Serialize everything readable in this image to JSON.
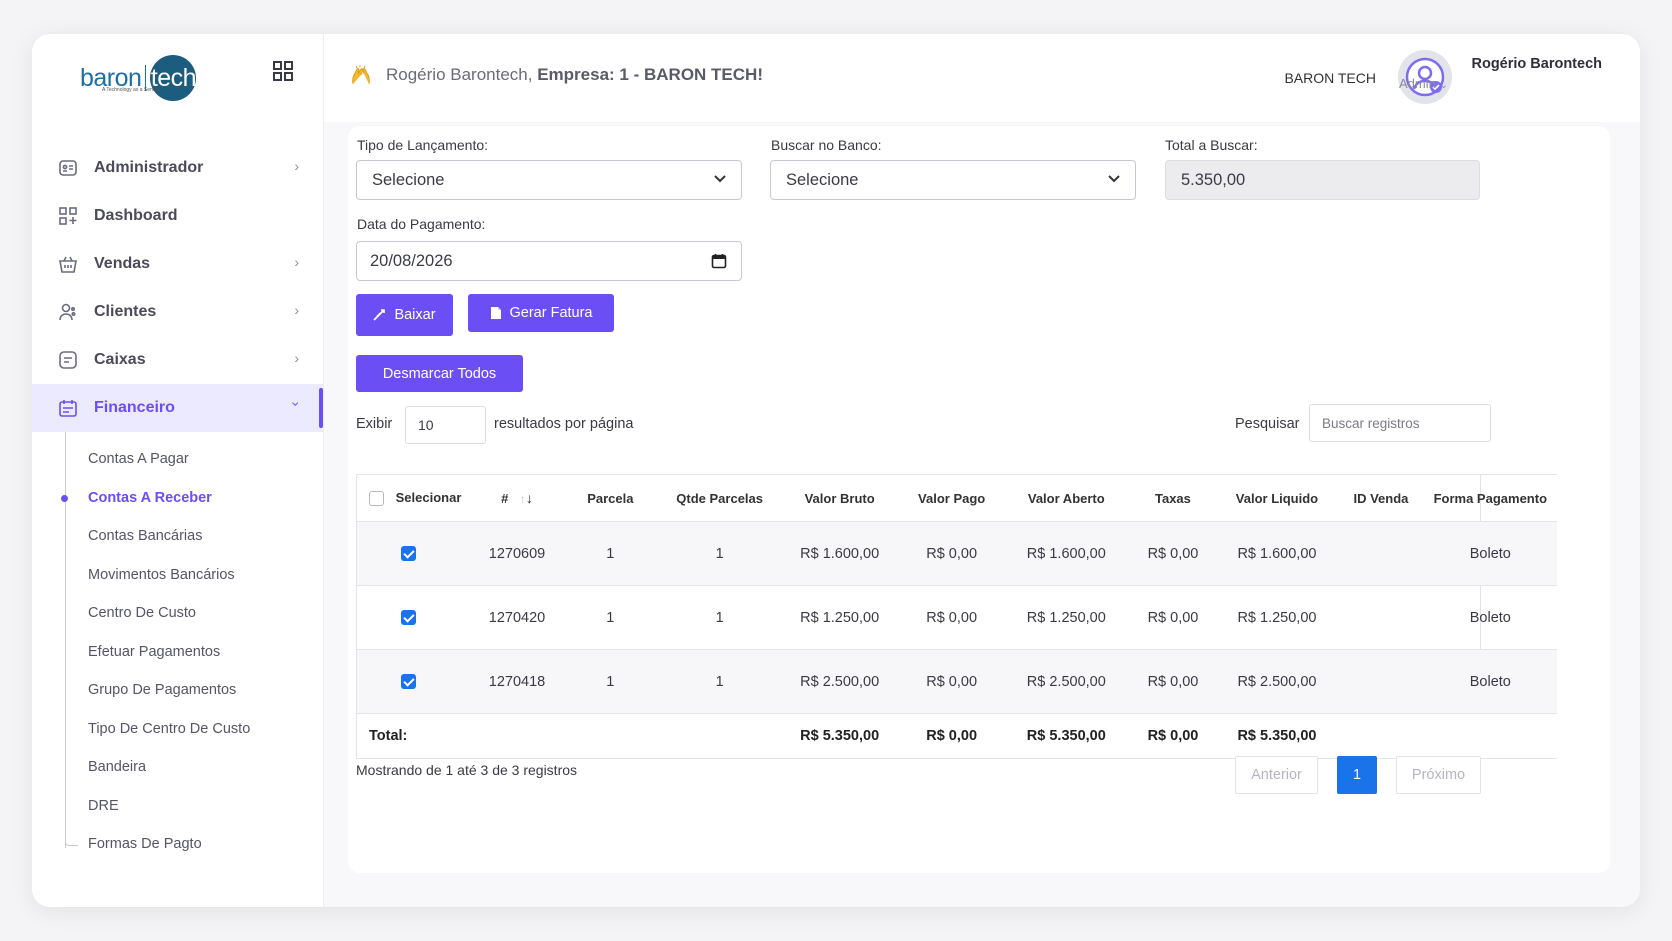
{
  "brand": {
    "logo_left": "baron",
    "logo_right": "tech",
    "tagline": "A Technology as a Service"
  },
  "sidebar": {
    "items": [
      {
        "label": "Administrador",
        "icon": "id-card-icon",
        "has_children": true
      },
      {
        "label": "Dashboard",
        "icon": "dashboard-grid-icon",
        "has_children": false
      },
      {
        "label": "Vendas",
        "icon": "basket-icon",
        "has_children": true
      },
      {
        "label": "Clientes",
        "icon": "users-icon",
        "has_children": true
      },
      {
        "label": "Caixas",
        "icon": "cashbox-icon",
        "has_children": true
      },
      {
        "label": "Financeiro",
        "icon": "calendar-icon",
        "has_children": true,
        "active": true
      }
    ],
    "submenu": [
      "Contas A Pagar",
      "Contas A Receber",
      "Contas Bancárias",
      "Movimentos Bancários",
      "Centro De Custo",
      "Efetuar Pagamentos",
      "Grupo De Pagamentos",
      "Tipo De Centro De Custo",
      "Bandeira",
      "DRE",
      "Formas De Pagto"
    ],
    "submenu_active_index": 1
  },
  "header": {
    "greeting_user": "Rogério Barontech,",
    "greeting_company": "Empresa: 1 - BARON TECH!",
    "company": "BARON TECH",
    "user_name": "Rogério Barontech",
    "user_role": "Admin"
  },
  "form": {
    "tipo_label": "Tipo de Lançamento:",
    "tipo_value": "Selecione",
    "banco_label": "Buscar no Banco:",
    "banco_value": "Selecione",
    "total_label": "Total a Buscar:",
    "total_value": "5.350,00",
    "data_label": "Data do Pagamento:",
    "data_value": "20/08/2026"
  },
  "buttons": {
    "baixar": "Baixar",
    "gerar_fatura": "Gerar Fatura",
    "desmarcar": "Desmarcar Todos"
  },
  "table_controls": {
    "show_label": "Exibir",
    "page_length": "10",
    "per_page_label": "resultados por página",
    "search_label": "Pesquisar",
    "search_placeholder": "Buscar registros"
  },
  "table": {
    "columns": [
      "Selecionar",
      "#",
      "Parcela",
      "Qtde Parcelas",
      "Valor Bruto",
      "Valor Pago",
      "Valor Aberto",
      "Taxas",
      "Valor Liquido",
      "ID Venda",
      "Forma Pagamento"
    ],
    "rows": [
      {
        "selected": true,
        "id": "1270609",
        "parcela": "1",
        "qtde": "1",
        "bruto": "R$ 1.600,00",
        "pago": "R$ 0,00",
        "aberto": "R$ 1.600,00",
        "taxas": "R$ 0,00",
        "liquido": "R$ 1.600,00",
        "id_venda": "",
        "forma": "Boleto"
      },
      {
        "selected": true,
        "id": "1270420",
        "parcela": "1",
        "qtde": "1",
        "bruto": "R$ 1.250,00",
        "pago": "R$ 0,00",
        "aberto": "R$ 1.250,00",
        "taxas": "R$ 0,00",
        "liquido": "R$ 1.250,00",
        "id_venda": "",
        "forma": "Boleto"
      },
      {
        "selected": true,
        "id": "1270418",
        "parcela": "1",
        "qtde": "1",
        "bruto": "R$ 2.500,00",
        "pago": "R$ 0,00",
        "aberto": "R$ 2.500,00",
        "taxas": "R$ 0,00",
        "liquido": "R$ 2.500,00",
        "id_venda": "",
        "forma": "Boleto"
      }
    ],
    "footer": {
      "label": "Total:",
      "bruto": "R$ 5.350,00",
      "pago": "R$ 0,00",
      "aberto": "R$ 5.350,00",
      "taxas": "R$ 0,00",
      "liquido": "R$ 5.350,00"
    }
  },
  "pagination": {
    "info": "Mostrando de 1 até 3 de 3 registros",
    "previous": "Anterior",
    "current": "1",
    "next": "Próximo"
  },
  "colors": {
    "accent": "#6c4ef5",
    "primary_blue": "#1a73e8",
    "brand_blue": "#1c5c7e"
  }
}
